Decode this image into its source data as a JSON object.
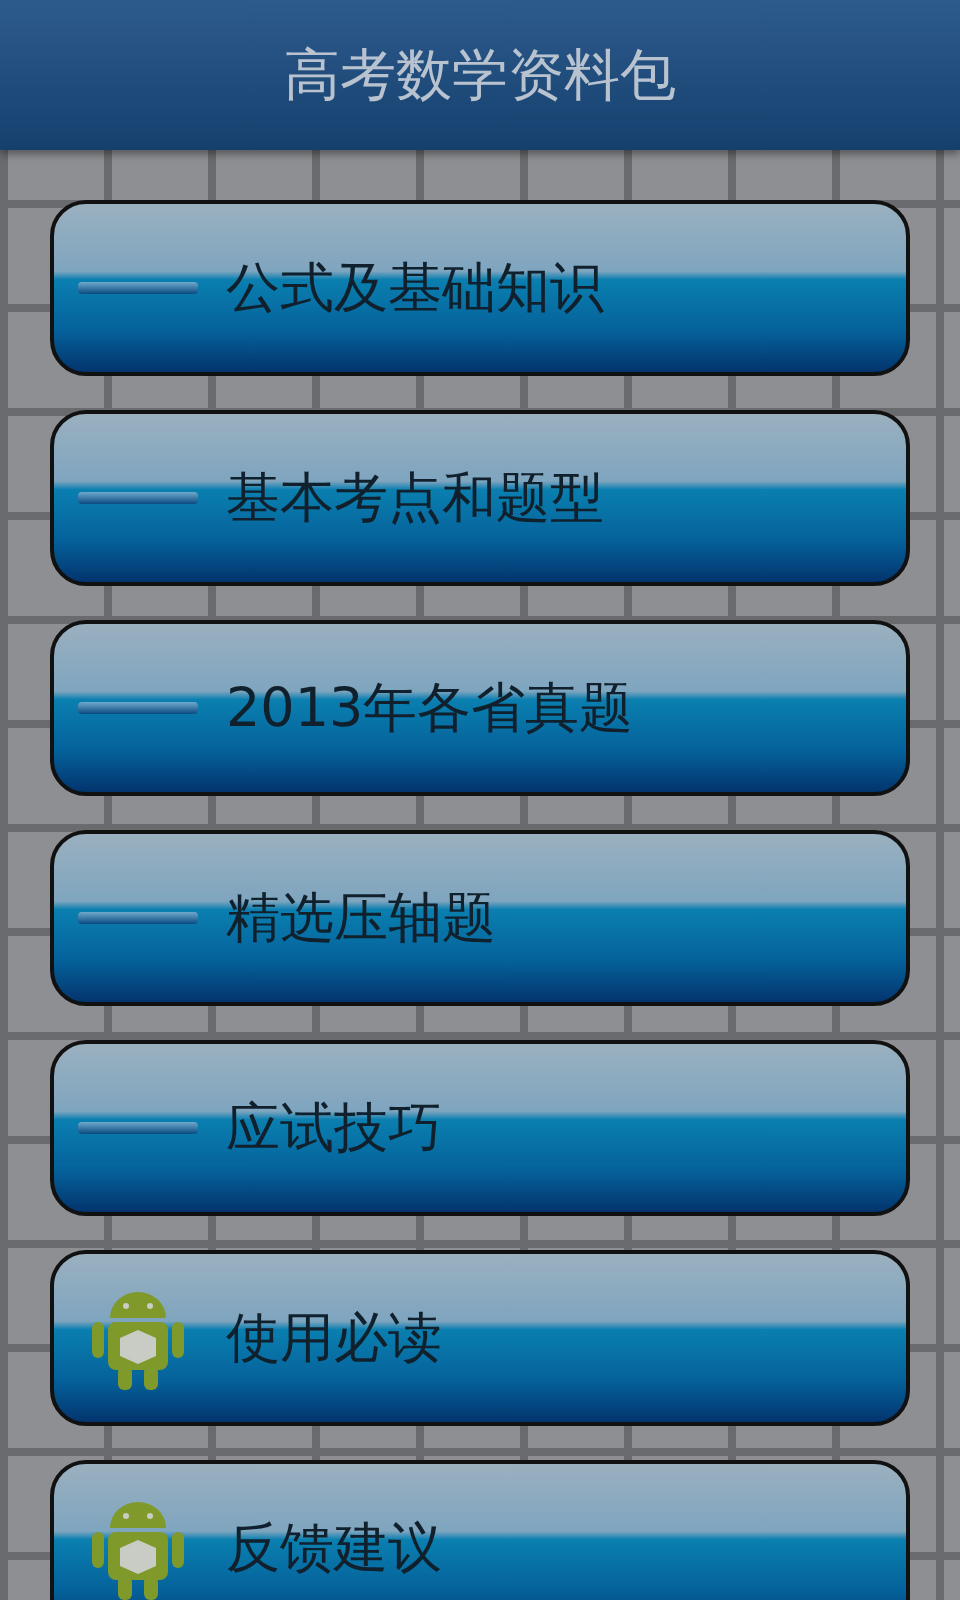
{
  "title": "高考数学资料包",
  "menu": [
    {
      "label": "公式及基础知识",
      "kind": "line"
    },
    {
      "label": "基本考点和题型",
      "kind": "line"
    },
    {
      "label": "2013年各省真题",
      "kind": "line"
    },
    {
      "label": "精选压轴题",
      "kind": "line"
    },
    {
      "label": "应试技巧",
      "kind": "line"
    },
    {
      "label": "使用必读",
      "kind": "android"
    },
    {
      "label": "反馈建议",
      "kind": "android"
    }
  ]
}
